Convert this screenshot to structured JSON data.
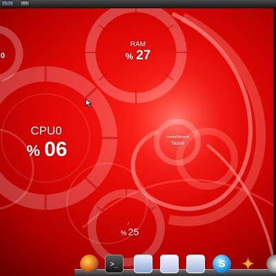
{
  "colors": {
    "accent": "#e00806",
    "gauge_ring": "#ffffff",
    "text": "#ffffff"
  },
  "topbar": {
    "buttons": [
      {
        "icon": "down-arrow-icon",
        "glyph": "▼"
      },
      {
        "icon": "window-icon",
        "glyph": "▭"
      }
    ]
  },
  "gauges": {
    "cpu": {
      "label": "CPU0",
      "percent_symbol": "%",
      "value": "06",
      "level": 0.06
    },
    "ram": {
      "label": "RAM",
      "percent_symbol": "%",
      "value": "27",
      "level": 0.27
    },
    "network": {
      "label": "media/Network",
      "value": "None"
    },
    "disk": {
      "label": "/",
      "percent_symbol": "%",
      "value": "25",
      "level": 0.25
    },
    "left_partial": {
      "value": "0"
    }
  },
  "dock": {
    "items": [
      {
        "name": "firefox-icon",
        "glyph": ""
      },
      {
        "name": "terminal-icon",
        "glyph": ">_"
      },
      {
        "name": "text-editor-icon",
        "glyph": ""
      },
      {
        "name": "image-viewer-icon",
        "glyph": ""
      },
      {
        "name": "document-icon",
        "glyph": ""
      },
      {
        "name": "skype-icon",
        "glyph": "S"
      },
      {
        "name": "pinwheel-icon",
        "glyph": "✦"
      },
      {
        "name": "disc-icon",
        "glyph": ""
      }
    ]
  }
}
